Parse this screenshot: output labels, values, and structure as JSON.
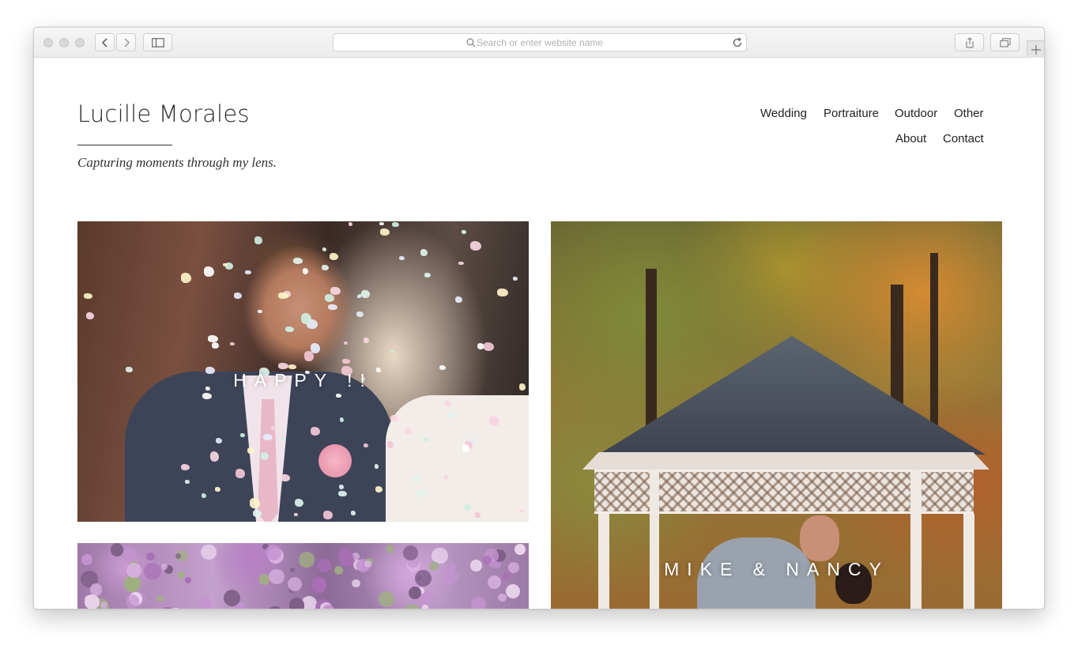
{
  "browser": {
    "address_placeholder": "Search or enter website name",
    "icons": [
      "close-window-icon",
      "minimize-window-icon",
      "zoom-window-icon",
      "back-arrow-icon",
      "forward-arrow-icon",
      "sidebar-icon",
      "search-icon",
      "reload-icon",
      "share-icon",
      "tabs-icon",
      "new-tab-plus-icon"
    ]
  },
  "site": {
    "title": "Lucille Morales",
    "tagline": "Capturing moments through my lens."
  },
  "nav": {
    "wedding": "Wedding",
    "portraiture": "Portraiture",
    "outdoor": "Outdoor",
    "other": "Other",
    "about": "About",
    "contact": "Contact"
  },
  "gallery": {
    "tile1_caption": "HAPPY !!",
    "tile3_caption": "MIKE & NANCY"
  },
  "colors": {
    "text": "#222222",
    "caption": "#ffffff",
    "toolbar": "#ececec"
  }
}
